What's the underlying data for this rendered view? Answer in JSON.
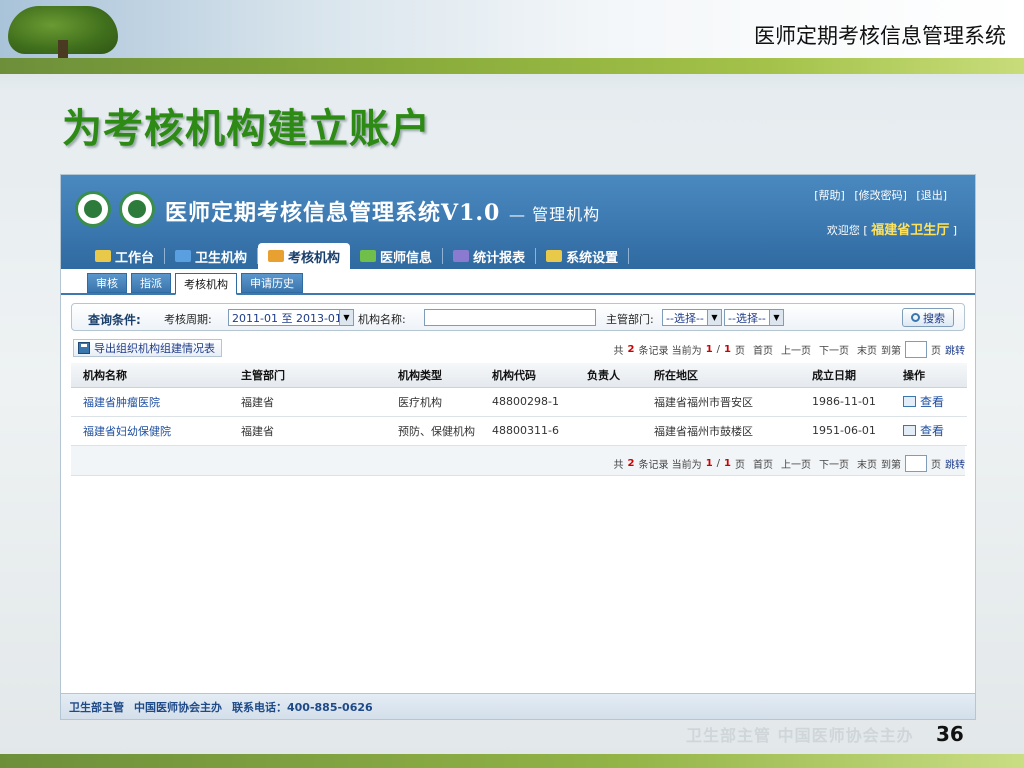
{
  "slide": {
    "header_title": "医师定期考核信息管理系统",
    "heading": "为考核机构建立账户",
    "page_number": "36",
    "watermark": "卫生部主管  中国医师协会主办"
  },
  "app": {
    "title": "医师定期考核信息管理系统V1.0",
    "subtitle": "— 管理机构",
    "top_links": [
      "[帮助]",
      "[修改密码]",
      "[退出]"
    ],
    "welcome_text": "欢迎您 [",
    "welcome_org": "福建省卫生厅",
    "welcome_close": "]",
    "nav": [
      {
        "label": "工作台",
        "icon_color": "#e9c94a"
      },
      {
        "label": "卫生机构",
        "icon_color": "#5aa0e0"
      },
      {
        "label": "考核机构",
        "icon_color": "#e8a030"
      },
      {
        "label": "医师信息",
        "icon_color": "#6fbf4a"
      },
      {
        "label": "统计报表",
        "icon_color": "#8a7ad0"
      },
      {
        "label": "系统设置",
        "icon_color": "#e9c94a"
      }
    ],
    "subtabs": [
      "审核",
      "指派",
      "考核机构",
      "申请历史"
    ],
    "query": {
      "label": "查询条件:",
      "period_label": "考核周期:",
      "period_value": "2011-01 至  2013-01",
      "name_label": "机构名称:",
      "name_value": "",
      "dept_label": "主管部门:",
      "dept_select1": "--选择--",
      "dept_select2": "--选择--",
      "search_label": "搜索"
    },
    "export_label": "导出组织机构组建情况表",
    "pager": {
      "total_prefix": "共",
      "total": "2",
      "total_suffix": "条记录  当前为",
      "current": "1",
      "slash": "/",
      "pages": "1",
      "page_suffix": "页",
      "first": "首页",
      "prev": "上一页",
      "next": "下一页",
      "last": "末页",
      "goto_prefix": "到第",
      "goto_suffix": "页",
      "jump": "跳转"
    },
    "table": {
      "headers": [
        "机构名称",
        "主管部门",
        "机构类型",
        "机构代码",
        "负责人",
        "所在地区",
        "成立日期",
        "操作"
      ],
      "rows": [
        {
          "name": "福建省肿瘤医院",
          "dept": "福建省",
          "type": "医疗机构",
          "code": "48800298-1",
          "person": "",
          "region": "福建省福州市晋安区",
          "date": "1986-11-01",
          "action": "查看"
        },
        {
          "name": "福建省妇幼保健院",
          "dept": "福建省",
          "type": "预防、保健机构",
          "code": "48800311-6",
          "person": "",
          "region": "福建省福州市鼓楼区",
          "date": "1951-06-01",
          "action": "查看"
        }
      ]
    },
    "footer": [
      "卫生部主管",
      "中国医师协会主办",
      "联系电话：400-885-0626"
    ]
  }
}
